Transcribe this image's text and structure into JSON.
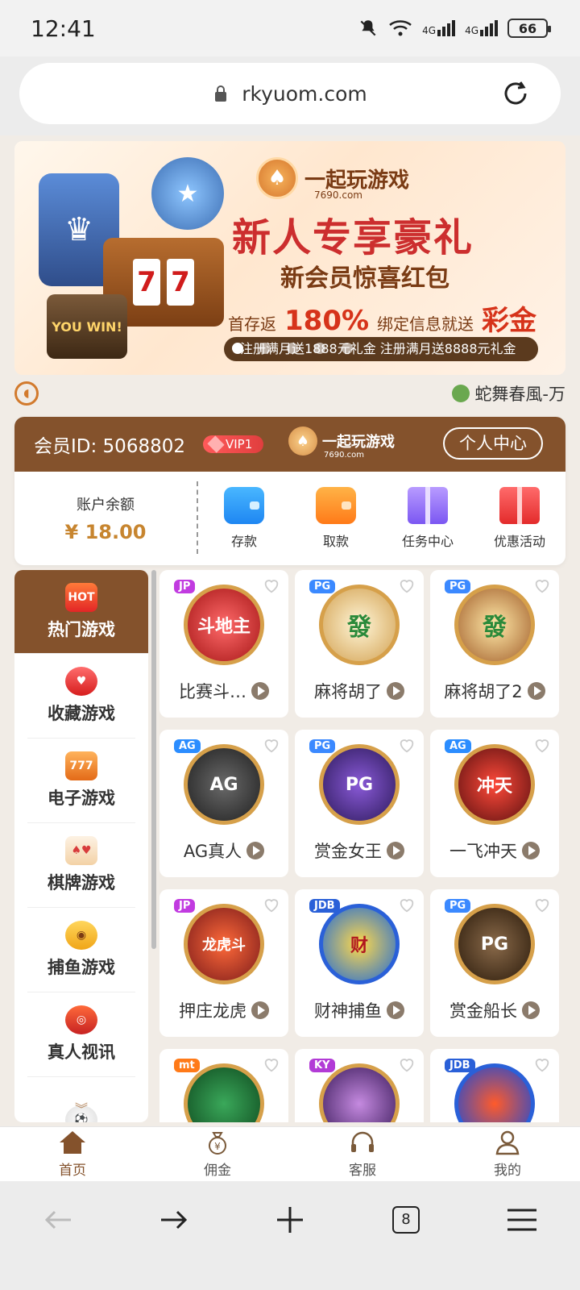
{
  "status_bar": {
    "time": "12:41",
    "signal_1": "4G",
    "signal_2": "4G",
    "battery": "66",
    "icons": [
      "mute-icon",
      "wifi-icon",
      "signal-icon",
      "signal-icon",
      "battery-icon"
    ]
  },
  "browser": {
    "url": "rkyuom.com",
    "tab_count": "8"
  },
  "banner": {
    "brand_name": "一起玩游戏",
    "brand_domain": "7690.com",
    "title": "新人专享豪礼",
    "subtitle": "新会员惊喜红包",
    "promo_prefix": "首存返",
    "promo_percent": "180%",
    "promo_middle": "绑定信息就送",
    "promo_suffix": "彩金",
    "ticker": "注册满月送1888元礼金  注册满月送8888元礼金",
    "slot_digits": [
      "7",
      "7"
    ],
    "win_text": "YOU WIN!"
  },
  "marquee": {
    "text": "蛇舞春風-万"
  },
  "member": {
    "id_label": "会员ID: 5068802",
    "vip": "VIP1",
    "brand_name": "一起玩游戏",
    "brand_domain": "7690.com",
    "center_button": "个人中心",
    "balance_label": "账户余额",
    "balance_value": "¥ 18.00",
    "actions": [
      {
        "label": "存款",
        "icon": "wallet-icon"
      },
      {
        "label": "取款",
        "icon": "wallet-icon"
      },
      {
        "label": "任务中心",
        "icon": "gift-icon"
      },
      {
        "label": "优惠活动",
        "icon": "gift-icon"
      }
    ]
  },
  "categories": [
    {
      "label": "热门游戏",
      "icon": "fire-icon",
      "badge": "HOT"
    },
    {
      "label": "收藏游戏",
      "icon": "heart-icon"
    },
    {
      "label": "电子游戏",
      "icon": "slot-machine-icon",
      "badge": "777"
    },
    {
      "label": "棋牌游戏",
      "icon": "cards-icon"
    },
    {
      "label": "捕鱼游戏",
      "icon": "fish-icon"
    },
    {
      "label": "真人视讯",
      "icon": "roulette-icon"
    },
    {
      "label": "",
      "icon": "soccer-ball-icon"
    }
  ],
  "games": [
    {
      "name": "比赛斗…",
      "tag": "JP",
      "thumb": "斗地主"
    },
    {
      "name": "麻将胡了",
      "tag": "PG",
      "thumb": "發"
    },
    {
      "name": "麻将胡了2",
      "tag": "PG",
      "thumb": "發"
    },
    {
      "name": "AG真人",
      "tag": "AG",
      "thumb": "AG"
    },
    {
      "name": "赏金女王",
      "tag": "PG",
      "thumb": "PG"
    },
    {
      "name": "一飞冲天",
      "tag": "AG",
      "thumb": "冲天"
    },
    {
      "name": "押庄龙虎",
      "tag": "JP",
      "thumb": "龙虎斗"
    },
    {
      "name": "财神捕鱼",
      "tag": "JDB",
      "thumb": "财"
    },
    {
      "name": "赏金船长",
      "tag": "PG",
      "thumb": "PG"
    },
    {
      "name": "",
      "tag": "mt",
      "thumb": ""
    },
    {
      "name": "",
      "tag": "KY",
      "thumb": ""
    },
    {
      "name": "",
      "tag": "JDB",
      "thumb": ""
    }
  ],
  "bottom_nav": [
    {
      "label": "首页",
      "icon": "home-icon"
    },
    {
      "label": "佣金",
      "icon": "money-bag-icon"
    },
    {
      "label": "客服",
      "icon": "headset-icon"
    },
    {
      "label": "我的",
      "icon": "user-icon"
    }
  ],
  "colors": {
    "primary": "#84522c",
    "accent": "#c7852f",
    "background": "#f1ece6"
  }
}
